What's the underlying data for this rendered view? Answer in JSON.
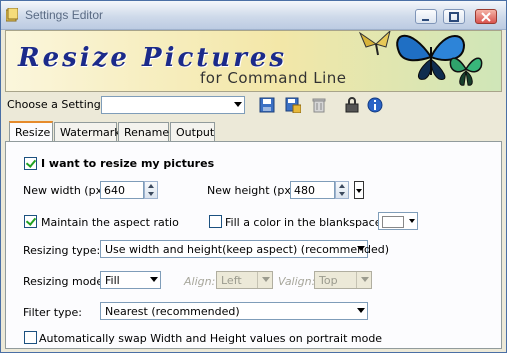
{
  "window": {
    "title": "Settings Editor",
    "controls": {
      "minimize_icon": "minimize-icon",
      "maximize_icon": "maximize-icon",
      "close_icon": "close-icon"
    }
  },
  "banner": {
    "title": "Resize Pictures",
    "subtitle": "for Command Line"
  },
  "settings_bar": {
    "choose_label": "Choose a Settings:",
    "selected_value": "",
    "icons": [
      "save-icon",
      "save-as-icon",
      "delete-icon",
      "lock-icon",
      "info-icon"
    ]
  },
  "tabs": [
    {
      "label": "Resize",
      "active": true
    },
    {
      "label": "Watermark",
      "active": false
    },
    {
      "label": "Rename",
      "active": false
    },
    {
      "label": "Output",
      "active": false
    }
  ],
  "resize": {
    "enable_label": "I want to resize my pictures",
    "enable_checked": true,
    "width_label": "New width (px):",
    "width_value": "640",
    "height_label": "New height (px):",
    "height_value": "480",
    "aspect_label": "Maintain the aspect ratio",
    "aspect_checked": true,
    "fill_label": "Fill a color in the blankspace:",
    "fill_checked": false,
    "fill_color": "#ffffff",
    "type_label": "Resizing type:",
    "type_value": "Use width and height(keep aspect) (recommended)",
    "mode_label": "Resizing mode:",
    "mode_value": "Fill",
    "align_label": "Align:",
    "align_value": "Left",
    "valign_label": "Valign:",
    "valign_value": "Top",
    "filter_label": "Filter type:",
    "filter_value": "Nearest (recommended)",
    "swap_label": "Automatically swap Width and Height values on portrait mode",
    "swap_checked": false
  },
  "colors": {
    "title_bar": "#cfdaea",
    "accent_tab": "#e68b2c",
    "banner_text": "#1b2a8a",
    "check_mark": "#21a121"
  }
}
